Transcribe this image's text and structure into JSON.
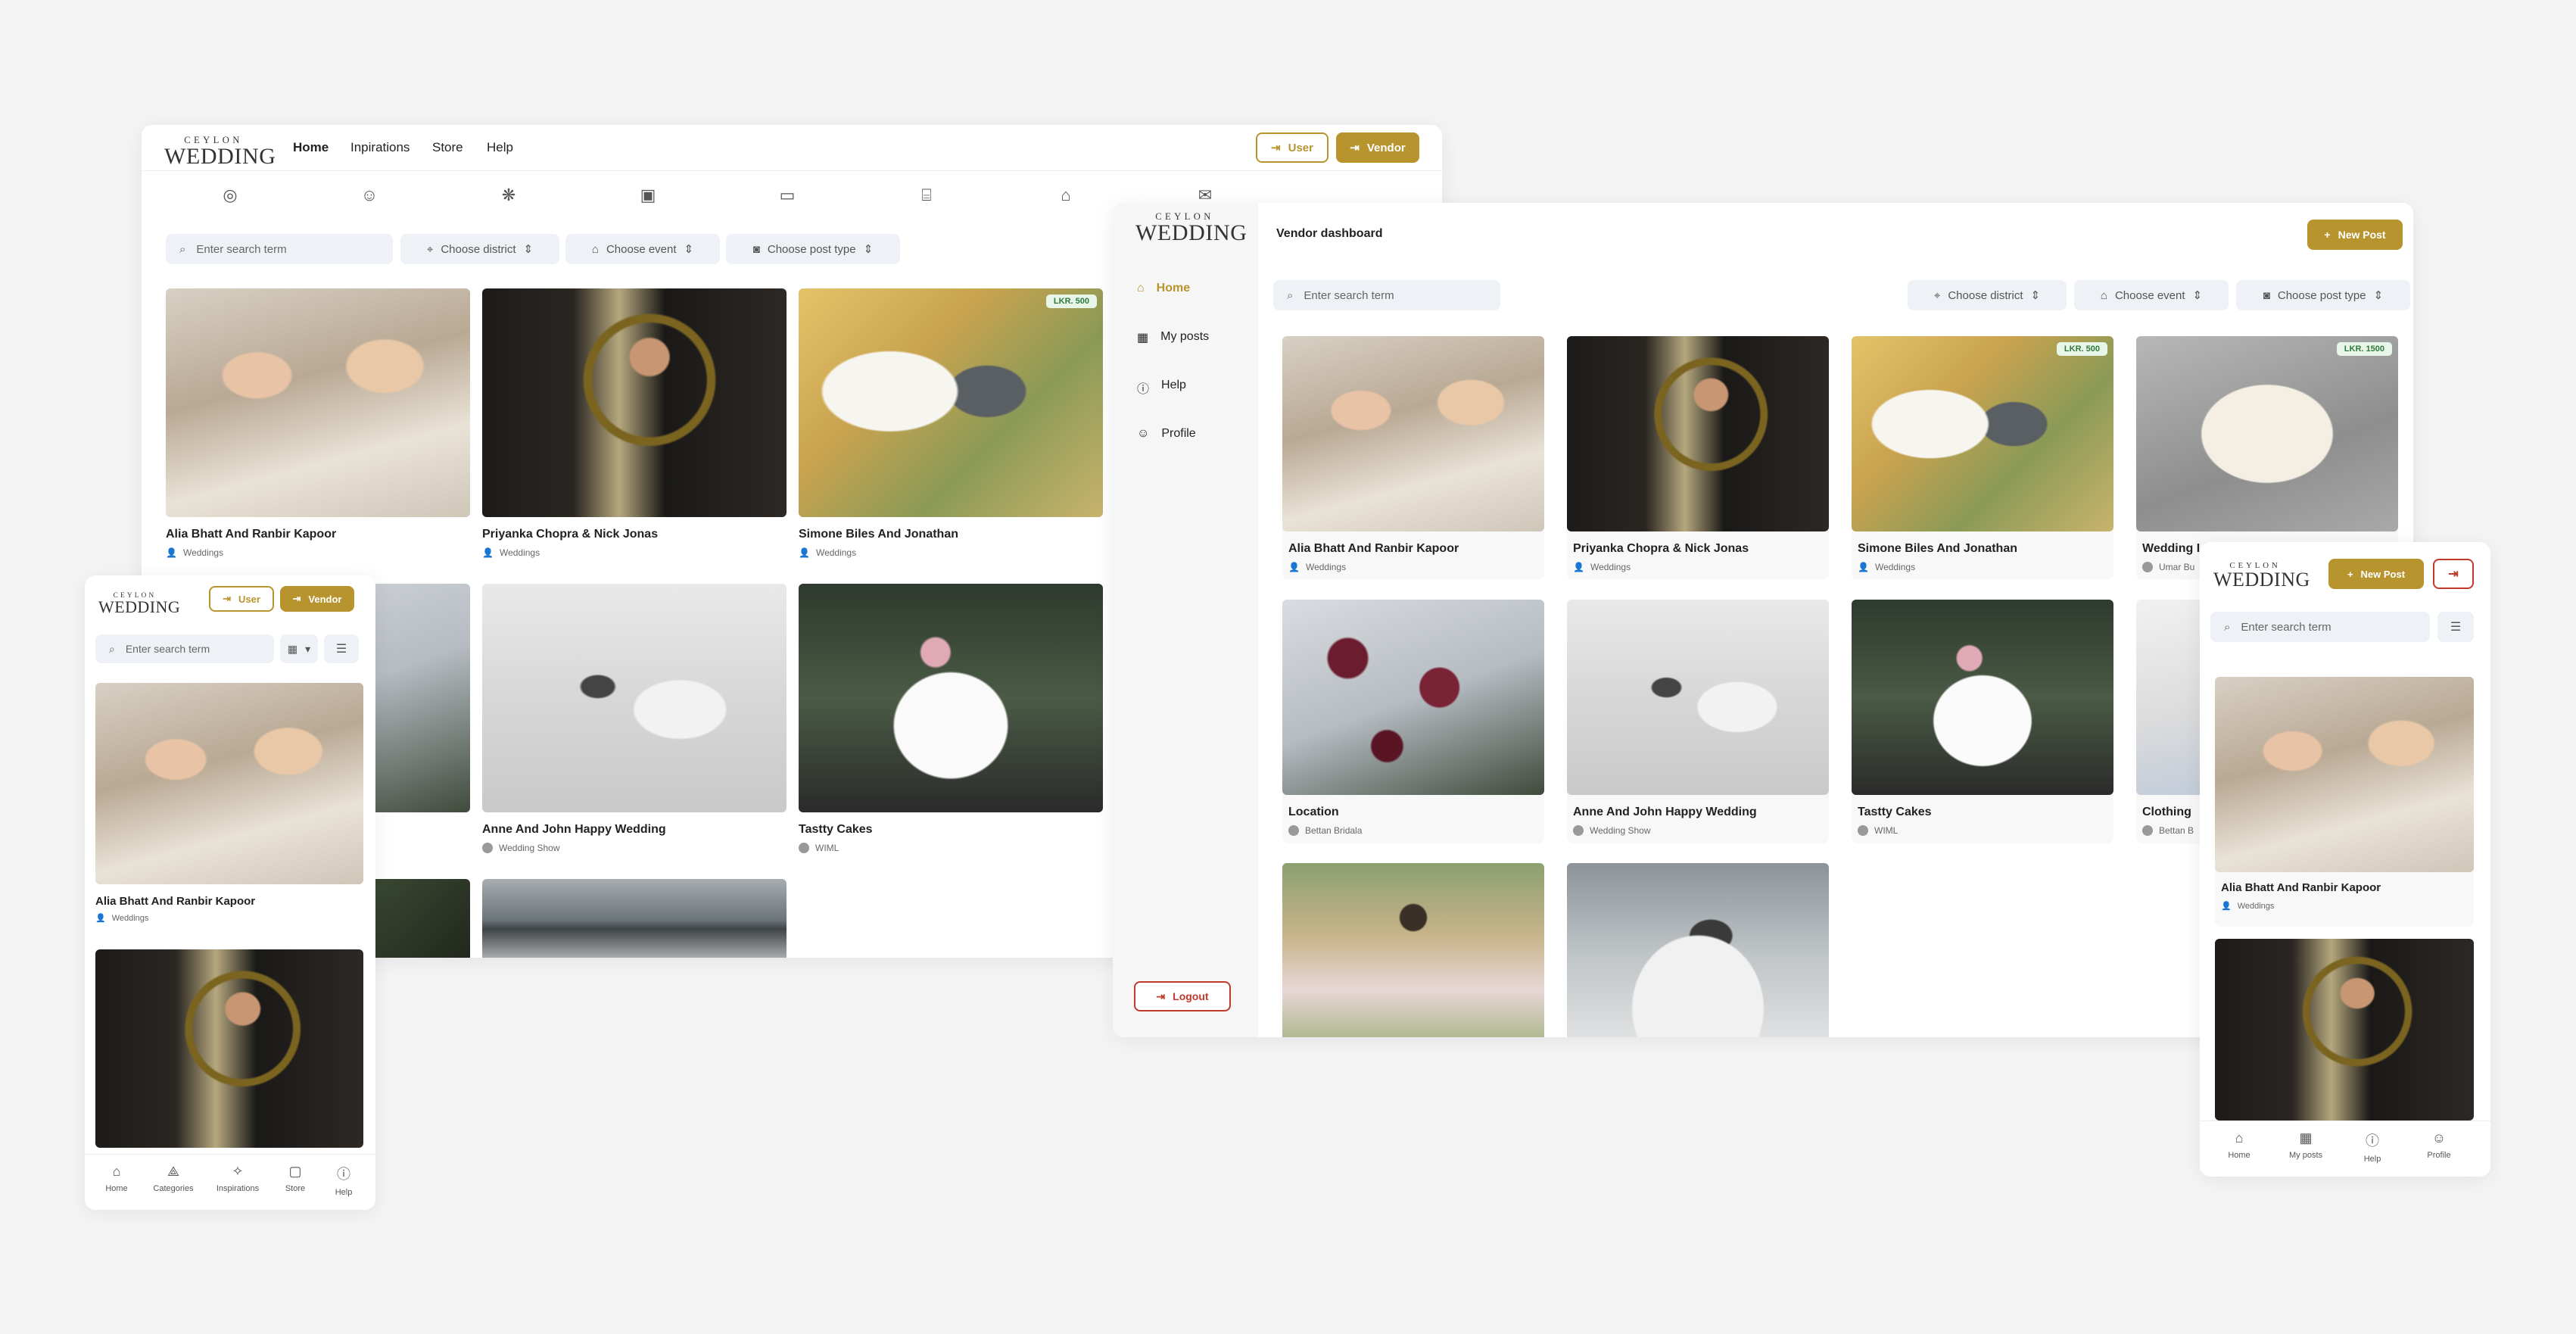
{
  "brand": {
    "line1": "CEYLON",
    "line2": "WEDDING",
    "accent": "#b8942f"
  },
  "desktop": {
    "nav": [
      "Home",
      "Inpirations",
      "Store",
      "Help"
    ],
    "user_btn": "User",
    "vendor_btn": "Vendor",
    "search_placeholder": "Enter search term",
    "filters": [
      "Choose district",
      "Choose event",
      "Choose post type"
    ],
    "category_icons": [
      "rings-icon",
      "makeup-icon",
      "flower-icon",
      "photo-icon",
      "venue-icon",
      "cake-table-icon",
      "cake-icon",
      "invitation-icon",
      "music-icon"
    ],
    "posts": [
      {
        "title": "Alia Bhatt And Ranbir Kapoor",
        "author": "Weddings"
      },
      {
        "title": "Priyanka Chopra & Nick Jonas",
        "author": "Weddings"
      },
      {
        "title": "Simone Biles And Jonathan",
        "author": "Weddings",
        "price": "LKR. 500"
      },
      {
        "title": "Anne And John Happy Wedding",
        "author": "Wedding Show"
      },
      {
        "title": "Tastty Cakes",
        "author": "WIML"
      }
    ]
  },
  "vendor": {
    "title": "Vendor dashboard",
    "new_post": "New Post",
    "search_placeholder": "Enter search term",
    "filters": [
      "Choose district",
      "Choose event",
      "Choose post type"
    ],
    "sidebar": [
      "Home",
      "My posts",
      "Help",
      "Profile"
    ],
    "logout": "Logout",
    "posts": [
      {
        "title": "Alia Bhatt And Ranbir Kapoor",
        "author": "Weddings"
      },
      {
        "title": "Priyanka Chopra & Nick Jonas",
        "author": "Weddings"
      },
      {
        "title": "Simone Biles And Jonathan",
        "author": "Weddings",
        "price": "LKR. 500"
      },
      {
        "title": "Wedding I",
        "author": "Umar Bu",
        "price": "LKR. 1500"
      },
      {
        "title": "Location",
        "author": "Bettan Bridala"
      },
      {
        "title": "Anne And John Happy Wedding",
        "author": "Wedding Show"
      },
      {
        "title": "Tastty Cakes",
        "author": "WIML"
      },
      {
        "title": "Clothing",
        "author": "Bettan B"
      }
    ]
  },
  "mobile_user": {
    "user_btn": "User",
    "vendor_btn": "Vendor",
    "search_placeholder": "Enter search term",
    "posts": [
      {
        "title": "Alia Bhatt And Ranbir Kapoor",
        "author": "Weddings"
      }
    ],
    "bottom_nav": [
      "Home",
      "Categories",
      "Inspirations",
      "Store",
      "Help"
    ]
  },
  "mobile_vendor": {
    "new_post": "New Post",
    "search_placeholder": "Enter search term",
    "posts": [
      {
        "title": "Alia Bhatt And Ranbir Kapoor",
        "author": "Weddings"
      }
    ],
    "bottom_nav": [
      "Home",
      "My posts",
      "Help",
      "Profile"
    ]
  }
}
